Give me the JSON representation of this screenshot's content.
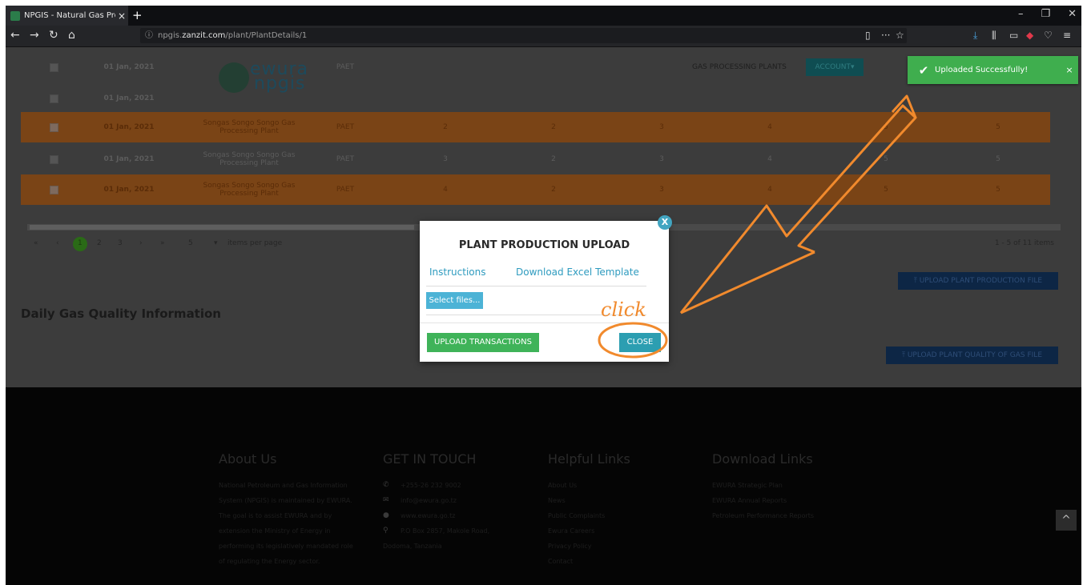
{
  "browser": {
    "tab_title": "NPGIS - Natural Gas Processing",
    "tab_close": "×",
    "new_tab": "+",
    "url_prefix": "npgis.",
    "url_host": "zanzit.com",
    "url_path": "/plant/PlantDetails/1",
    "url_menu": "···",
    "win_min": "–",
    "win_max": "❐",
    "win_close": "✕"
  },
  "header": {
    "logo_line1": "ewura",
    "logo_line2": "npgis",
    "nav_plants": "GAS PROCESSING PLANTS",
    "account_label": "ACCOUNT▾"
  },
  "table": {
    "rows": [
      {
        "date": "01 Jan, 2021",
        "plant": "",
        "type": "PAET",
        "v1": "",
        "v2": "",
        "v3": "",
        "v4": "",
        "v5": "",
        "v6": "",
        "style": "dim"
      },
      {
        "date": "01 Jan, 2021",
        "plant": "",
        "type": "",
        "v1": "",
        "v2": "",
        "v3": "",
        "v4": "",
        "v5": "",
        "v6": "",
        "style": "dim"
      },
      {
        "date": "01 Jan, 2021",
        "plant": "Songas Songo Songo Gas Processing Plant",
        "type": "PAET",
        "v1": "2",
        "v2": "2",
        "v3": "3",
        "v4": "4",
        "v5": "5",
        "v6": "5",
        "style": "orange"
      },
      {
        "date": "01 Jan, 2021",
        "plant": "Songas Songo Songo Gas Processing Plant",
        "type": "PAET",
        "v1": "3",
        "v2": "2",
        "v3": "3",
        "v4": "4",
        "v5": "5",
        "v6": "5",
        "style": "dim"
      },
      {
        "date": "01 Jan, 2021",
        "plant": "Songas Songo Songo Gas Processing Plant",
        "type": "PAET",
        "v1": "4",
        "v2": "2",
        "v3": "3",
        "v4": "4",
        "v5": "5",
        "v6": "5",
        "style": "orange"
      }
    ],
    "pager": {
      "first": "«",
      "prev": "‹",
      "pages": [
        "1",
        "2",
        "3"
      ],
      "next": "›",
      "last": "»",
      "per_page_value": "5",
      "per_page_label": "items per page",
      "summary": "1 - 5 of 11 items"
    }
  },
  "upload_production_btn": "⤒ UPLOAD PLANT PRODUCTION FILE",
  "section_quality_title": "Daily Gas Quality Information",
  "upload_quality_btn": "⤒ UPLOAD PLANT QUALITY OF GAS FILE",
  "footer": {
    "about_title": "About Us",
    "about_lines": [
      "National Petroleum and Gas Information",
      "System (NPGIS) is maintained by EWURA.",
      "The goal is to assist EWURA and by",
      "extension the Ministry of Energy in",
      "performing its legislatively mandated role",
      "of regulating the Energy sector."
    ],
    "contact_title": "GET IN TOUCH",
    "contact_phone": "+255-26 232 9002",
    "contact_email": "info@ewura.go.tz",
    "contact_web": "www.ewura.go.tz",
    "contact_addr1": "P.O Box 2857, Makole Road,",
    "contact_addr2": "Dodoma, Tanzania",
    "helpful_title": "Helpful Links",
    "helpful_links": [
      "About Us",
      "News",
      "Public Complaints",
      "Ewura Careers",
      "Privacy Policy",
      "Contact"
    ],
    "download_title": "Download Links",
    "download_links": [
      "EWURA Strategic Plan",
      "EWURA Annual Reports",
      "Petroleum Performance Reports"
    ]
  },
  "toast": {
    "message": "Uploaded Successfully!",
    "close": "×",
    "color": "#3fae4e"
  },
  "modal": {
    "title": "PLANT PRODUCTION UPLOAD",
    "link_instructions": "Instructions",
    "link_template": "Download Excel Template",
    "select_files": "Select files...",
    "upload_button": "UPLOAD TRANSACTIONS",
    "close_button": "CLOSE",
    "close_x": "X"
  },
  "annotation": {
    "text": "click",
    "color": "#f18a2d"
  },
  "scroll_top": "^"
}
